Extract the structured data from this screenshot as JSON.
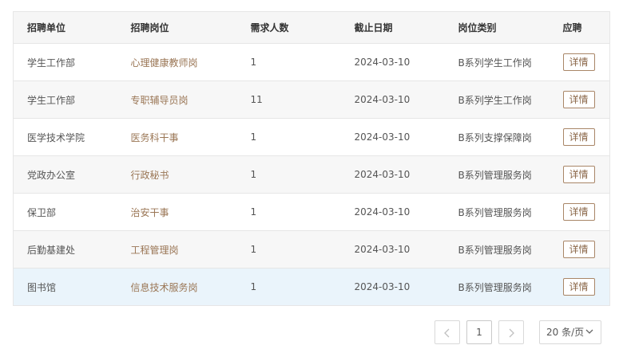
{
  "table": {
    "headers": [
      "招聘单位",
      "招聘岗位",
      "需求人数",
      "截止日期",
      "岗位类别",
      "应聘"
    ],
    "detail_label": "详情",
    "rows": [
      {
        "unit": "学生工作部",
        "post": "心理健康教师岗",
        "count": "1",
        "deadline": "2024-03-10",
        "category": "B系列学生工作岗"
      },
      {
        "unit": "学生工作部",
        "post": "专职辅导员岗",
        "count": "11",
        "deadline": "2024-03-10",
        "category": "B系列学生工作岗"
      },
      {
        "unit": "医学技术学院",
        "post": "医务科干事",
        "count": "1",
        "deadline": "2024-03-10",
        "category": "B系列支撑保障岗"
      },
      {
        "unit": "党政办公室",
        "post": "行政秘书",
        "count": "1",
        "deadline": "2024-03-10",
        "category": "B系列管理服务岗"
      },
      {
        "unit": "保卫部",
        "post": "治安干事",
        "count": "1",
        "deadline": "2024-03-10",
        "category": "B系列管理服务岗"
      },
      {
        "unit": "后勤基建处",
        "post": "工程管理岗",
        "count": "1",
        "deadline": "2024-03-10",
        "category": "B系列管理服务岗"
      },
      {
        "unit": "图书馆",
        "post": "信息技术服务岗",
        "count": "1",
        "deadline": "2024-03-10",
        "category": "B系列管理服务岗"
      }
    ]
  },
  "pagination": {
    "prev_icon": "chevron-left-icon",
    "next_icon": "chevron-right-icon",
    "current_page": "1",
    "page_size": "20 条/页"
  },
  "colors": {
    "post_link": "#9a7655",
    "detail_border": "#a98667",
    "hover_row": "#eaf4fb",
    "stripe_row": "#f7f7f7"
  }
}
